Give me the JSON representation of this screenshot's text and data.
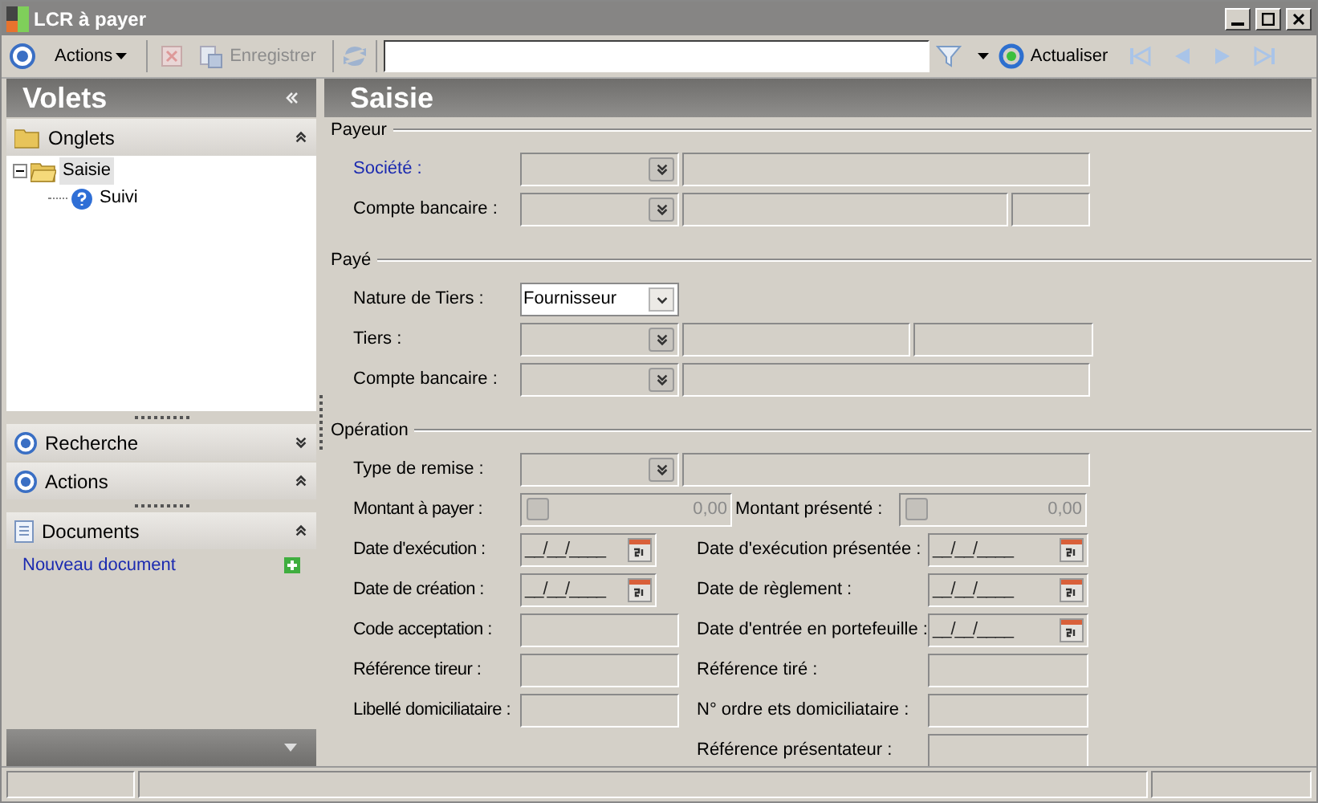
{
  "window": {
    "title": "LCR à payer"
  },
  "toolbar": {
    "actions_menu": "Actions",
    "save": "Enregistrer",
    "refresh": "Actualiser"
  },
  "left_panel": {
    "title": "Volets",
    "sections": [
      {
        "kind": "folder",
        "title": "Onglets",
        "expanded": true,
        "tree": [
          {
            "label": "Saisie",
            "selected": true,
            "children": [
              {
                "label": "Suivi",
                "selected": false
              }
            ]
          }
        ]
      },
      {
        "kind": "target",
        "title": "Recherche",
        "expanded": false
      },
      {
        "kind": "target",
        "title": "Actions",
        "expanded": true
      },
      {
        "kind": "document",
        "title": "Documents",
        "expanded": true,
        "links": [
          "Nouveau document"
        ]
      }
    ]
  },
  "form": {
    "title": "Saisie",
    "groups": [
      {
        "title": "Payeur",
        "rows": [
          {
            "kind": "combo_wide",
            "label": "Société :",
            "highlighted": true
          },
          {
            "kind": "combo_split",
            "label": "Compte bancaire  :",
            "highlighted": false
          }
        ]
      },
      {
        "title": "Payé",
        "rows": [
          {
            "kind": "select",
            "label": "Nature de Tiers :",
            "value": "Fournisseur",
            "highlighted": false
          },
          {
            "kind": "combo_half",
            "label": "Tiers :",
            "highlighted": false
          },
          {
            "kind": "combo_wide",
            "label": "Compte bancaire :",
            "highlighted": false
          }
        ]
      },
      {
        "title": "Opération",
        "rows": [
          {
            "kind": "combo_wide",
            "label": "Type de remise :",
            "highlighted": false
          }
        ],
        "pairs": [
          {
            "left": {
              "kind": "amount",
              "label": "Montant à payer :",
              "value": "0,00"
            },
            "right": {
              "kind": "amount",
              "label": "Montant présenté :",
              "value": "0,00"
            }
          },
          {
            "left": {
              "kind": "date",
              "label": "Date d'exécution :",
              "value": "__/__/____"
            },
            "right": {
              "kind": "date",
              "label": "Date d'exécution présentée :",
              "value": "__/__/____"
            }
          },
          {
            "left": {
              "kind": "date",
              "label": "Date de création :",
              "value": "__/__/____"
            },
            "right": {
              "kind": "date",
              "label": "Date de règlement :",
              "value": "__/__/____"
            }
          },
          {
            "left": {
              "kind": "text",
              "label": "Code acceptation :"
            },
            "right": {
              "kind": "date",
              "label": "Date d'entrée en portefeuille :",
              "value": "__/__/____"
            }
          },
          {
            "left": {
              "kind": "text",
              "label": "Référence tireur :"
            },
            "right": {
              "kind": "text",
              "label": "Référence tiré :"
            }
          },
          {
            "left": {
              "kind": "text",
              "label": "Libellé domiciliataire :"
            },
            "right": {
              "kind": "text",
              "label": "N° ordre ets domiciliataire :"
            }
          },
          {
            "right": {
              "kind": "text",
              "label": "Référence présentateur :"
            }
          }
        ]
      }
    ]
  }
}
